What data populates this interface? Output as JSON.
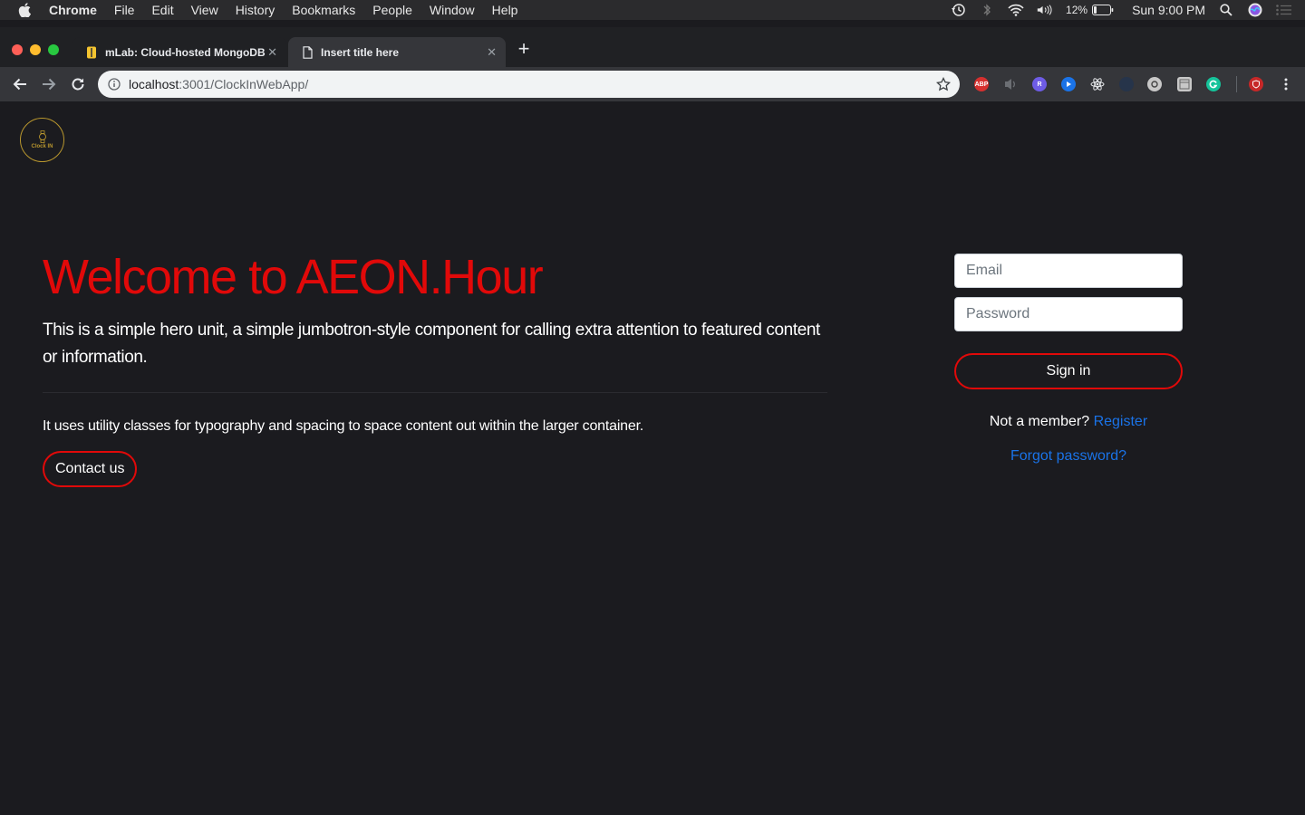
{
  "menubar": {
    "app_name": "Chrome",
    "items": [
      "File",
      "Edit",
      "View",
      "History",
      "Bookmarks",
      "People",
      "Window",
      "Help"
    ],
    "battery": "12%",
    "clock": "Sun 9:00 PM"
  },
  "tabs": [
    {
      "title": "mLab: Cloud-hosted MongoDB",
      "favicon": "mlab-icon"
    },
    {
      "title": "Insert title here",
      "favicon": "page-icon"
    }
  ],
  "address_bar": {
    "host": "localhost",
    "path": ":3001/ClockInWebApp/"
  },
  "extensions": [
    {
      "name": "adblock-icon",
      "label": "ABP",
      "color": "#d6302f"
    },
    {
      "name": "sound-icon",
      "label": "",
      "color": "#5f6368"
    },
    {
      "name": "r-extension-icon",
      "label": "R",
      "color": "#6e5ce6"
    },
    {
      "name": "play-icon",
      "label": "",
      "color": "#1a73e8"
    },
    {
      "name": "react-icon",
      "label": "",
      "color": "#35363a"
    },
    {
      "name": "dark-extension-icon",
      "label": "",
      "color": "#2a3b52"
    },
    {
      "name": "camera-icon",
      "label": "",
      "color": "#9aa0a6"
    },
    {
      "name": "window-icon",
      "label": "",
      "color": "#9aa0a6"
    },
    {
      "name": "grammarly-icon",
      "label": "",
      "color": "#15c39a"
    },
    {
      "name": "shield-extension-icon",
      "label": "",
      "color": "#c62828"
    }
  ],
  "logo": {
    "text": "Clock IN"
  },
  "hero": {
    "title": "Welcome to AEON.Hour",
    "lead": "This is a simple hero unit, a simple jumbotron-style component for calling extra attention to featured content or information.",
    "description": "It uses utility classes for typography and spacing to space content out within the larger container.",
    "contact_label": "Contact us"
  },
  "login": {
    "email_placeholder": "Email",
    "password_placeholder": "Password",
    "signin_label": "Sign in",
    "not_member_text": "Not a member? ",
    "register_label": "Register",
    "forgot_label": "Forgot password?"
  },
  "colors": {
    "accent": "#e10909",
    "link": "#1a73e8",
    "background": "#1b1b1f"
  }
}
